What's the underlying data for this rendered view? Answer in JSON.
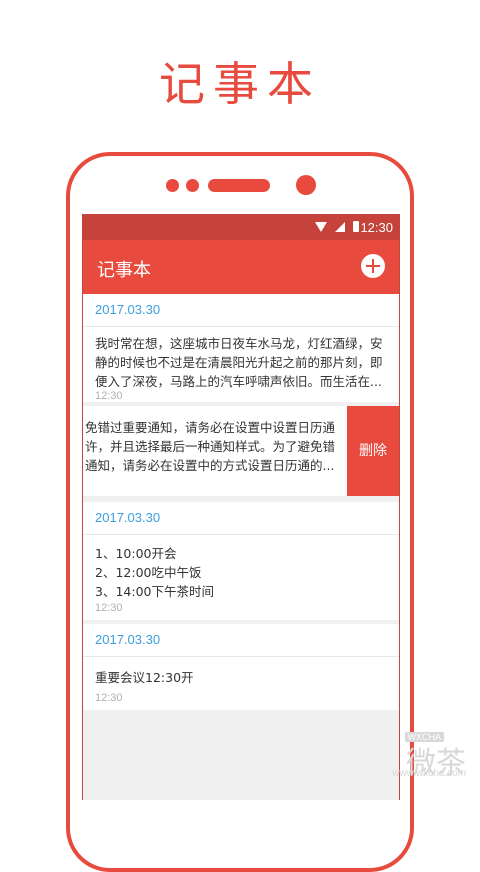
{
  "hero": {
    "title": "记事本"
  },
  "status_bar": {
    "time": "12:30"
  },
  "app_bar": {
    "title": "记事本"
  },
  "notes": [
    {
      "date": "2017.03.30",
      "body": "我时常在想，这座城市日夜车水马龙，灯红酒绿，安静的时候也不过是在清晨阳光升起之前的那片刻，即便入了深夜，马路上的汽车呼啸声依旧。而生活在...",
      "time": "12:30"
    },
    {
      "body": "免错过重要通知，请务必在设置中设置日历通许，并且选择最后一种通知样式。为了避免错通知，请务必在设置中的方式设置日历通的...",
      "action": "删除"
    },
    {
      "date": "2017.03.30",
      "lines": [
        "1、10:00开会",
        "2、12:00吃中午饭",
        "3、14:00下午茶时间"
      ],
      "time": "12:30"
    },
    {
      "date": "2017.03.30",
      "body": "重要会议12:30开",
      "time": "12:30"
    }
  ],
  "watermark": {
    "text": "微茶",
    "badge": "WXCHA",
    "url": "www.wxcha.com"
  },
  "colors": {
    "accent": "#e84a3e",
    "status_bar": "#c5433a",
    "date": "#3aa0dc"
  },
  "icons": {
    "add": "plus-circle-icon",
    "wifi": "wifi-icon",
    "signal": "signal-icon",
    "battery": "battery-icon"
  }
}
